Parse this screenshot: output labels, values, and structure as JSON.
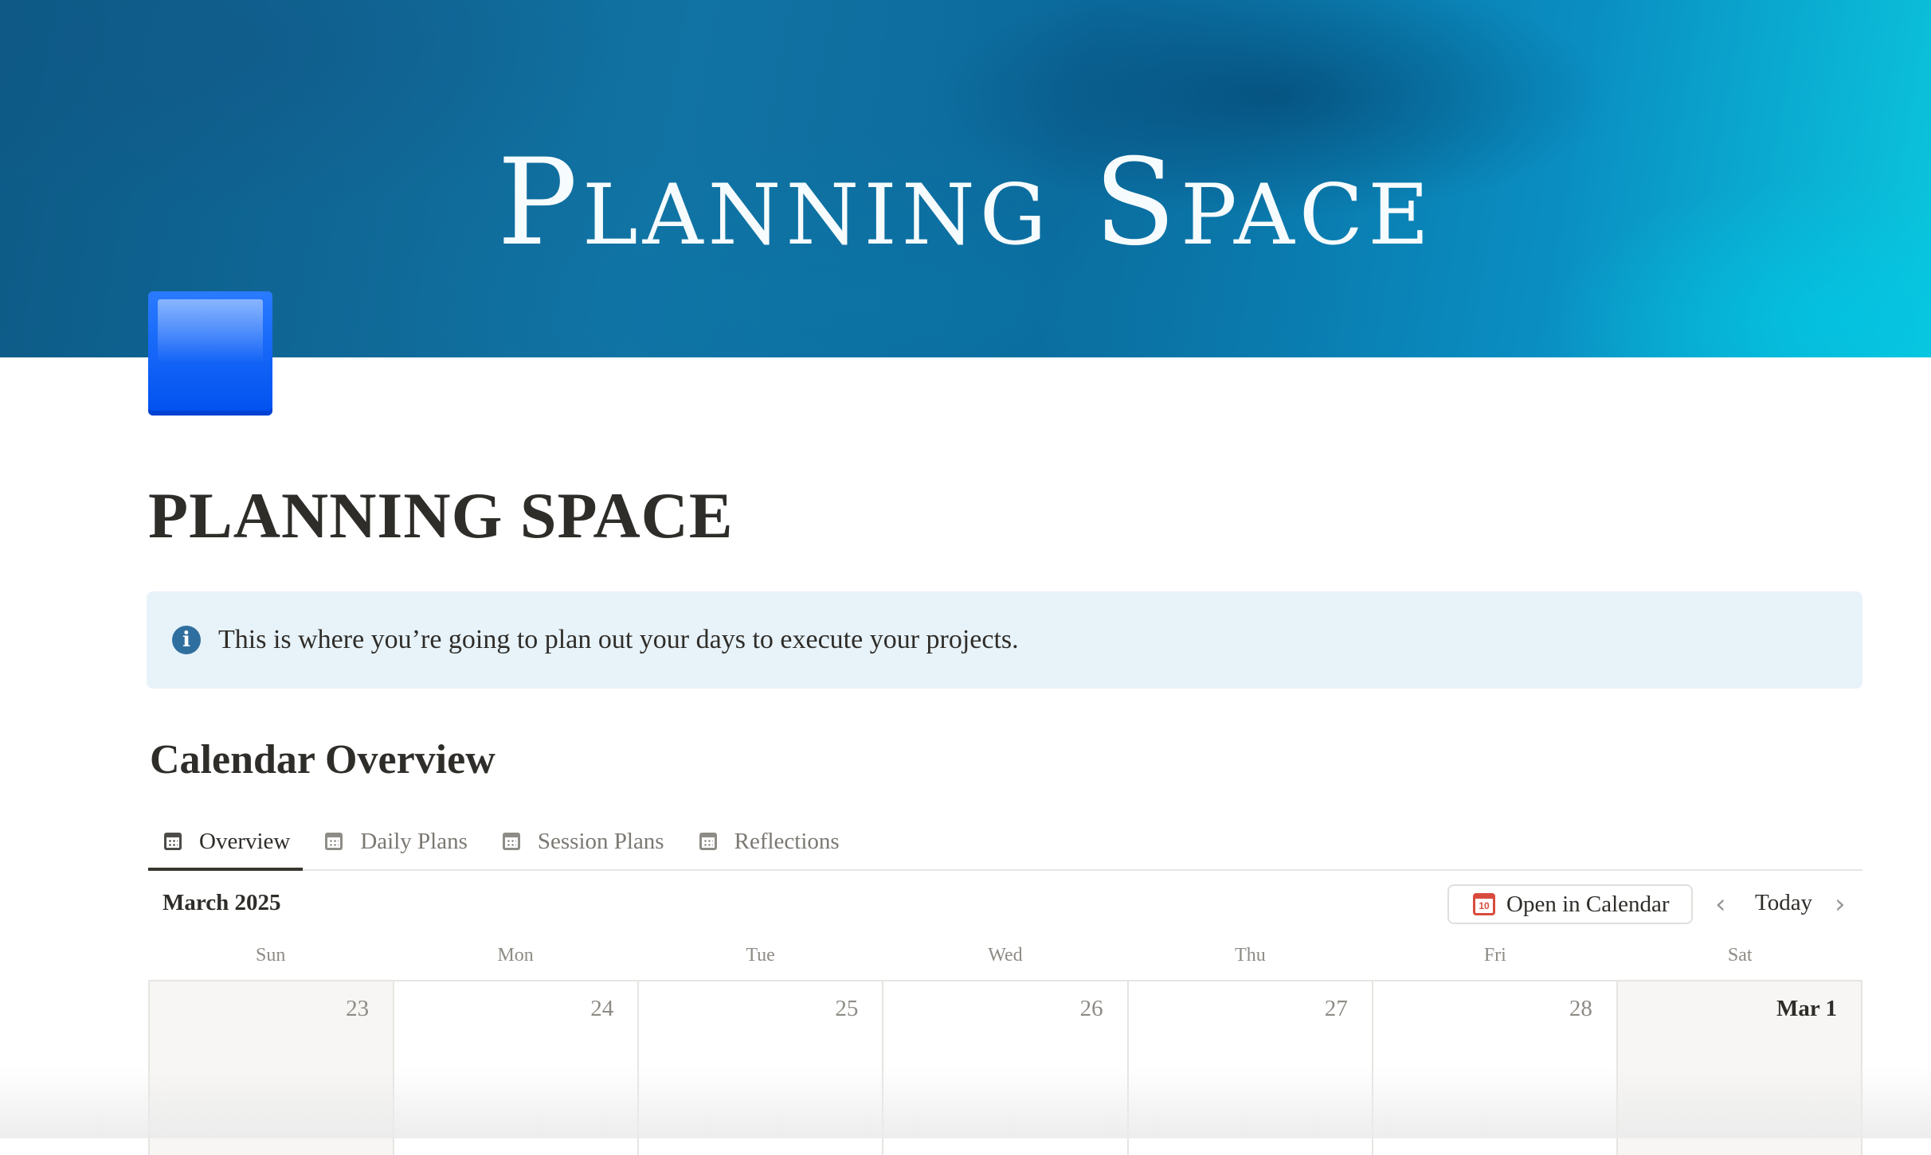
{
  "cover": {
    "title": "Planning Space"
  },
  "page": {
    "title": "PLANNING SPACE",
    "icon": "blue-square-icon"
  },
  "callout": {
    "icon": "info-icon",
    "icon_glyph": "i",
    "text": "This is where you’re going to plan out your days to execute your projects."
  },
  "section": {
    "heading": "Calendar Overview"
  },
  "tabs": [
    {
      "label": "Overview",
      "icon": "calendar-icon",
      "active": true
    },
    {
      "label": "Daily Plans",
      "icon": "calendar-icon",
      "active": false
    },
    {
      "label": "Session Plans",
      "icon": "calendar-icon",
      "active": false
    },
    {
      "label": "Reflections",
      "icon": "calendar-icon",
      "active": false
    }
  ],
  "calendar": {
    "month_label": "March 2025",
    "open_button_label": "Open in Calendar",
    "open_button_icon_text": "10",
    "prev_glyph": "‹",
    "next_glyph": "›",
    "today_label": "Today",
    "weekdays": [
      "Sun",
      "Mon",
      "Tue",
      "Wed",
      "Thu",
      "Fri",
      "Sat"
    ],
    "days": [
      "23",
      "24",
      "25",
      "26",
      "27",
      "28",
      "Mar 1"
    ]
  },
  "colors": {
    "accent_blue": "#0050f0",
    "callout_bg": "#e7f2f9",
    "info_icon": "#2f6f9f",
    "calendar_red": "#d94c3d"
  }
}
